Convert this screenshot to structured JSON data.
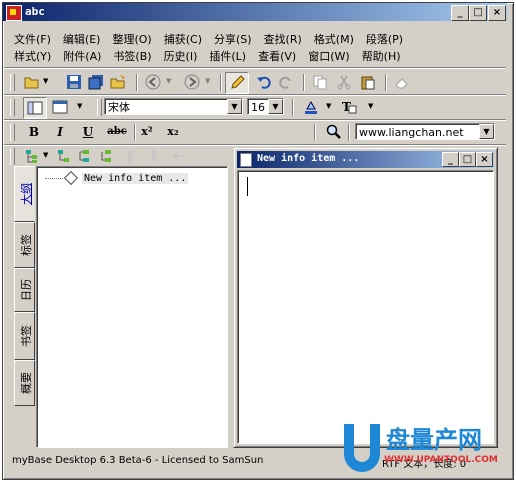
{
  "window": {
    "title": "abc"
  },
  "menu": {
    "row1": [
      "文件(F)",
      "编辑(E)",
      "整理(O)",
      "捕获(C)",
      "分享(S)",
      "查找(R)",
      "格式(M)",
      "段落(P)"
    ],
    "row2": [
      "样式(Y)",
      "附件(A)",
      "书签(B)",
      "历史(I)",
      "插件(L)",
      "查看(V)",
      "窗口(W)",
      "帮助(H)"
    ]
  },
  "toolbar": {
    "font_name": "宋体",
    "font_size": "16",
    "url": "www.liangchan.net"
  },
  "format": {
    "bold": "B",
    "italic": "I",
    "underline": "U",
    "strike": "abc",
    "superscript": "x²",
    "subscript": "x₂"
  },
  "sidebar_tabs": [
    "大纲",
    "标签",
    "日历",
    "书签",
    "概要"
  ],
  "tree": {
    "item": "New info item ..."
  },
  "child_window": {
    "title": "New info item ..."
  },
  "status": {
    "left": "myBase Desktop 6.3 Beta-6 - Licensed to SamSun",
    "right": "RTF 文本，长度: 0"
  },
  "watermark": {
    "brand": "盘量产网",
    "url": "WWW.UPANTOOL.COM"
  },
  "colors": {
    "title_start": "#0a246a",
    "title_end": "#a6caf0",
    "face": "#d4d0c8",
    "link": "#0000aa"
  }
}
